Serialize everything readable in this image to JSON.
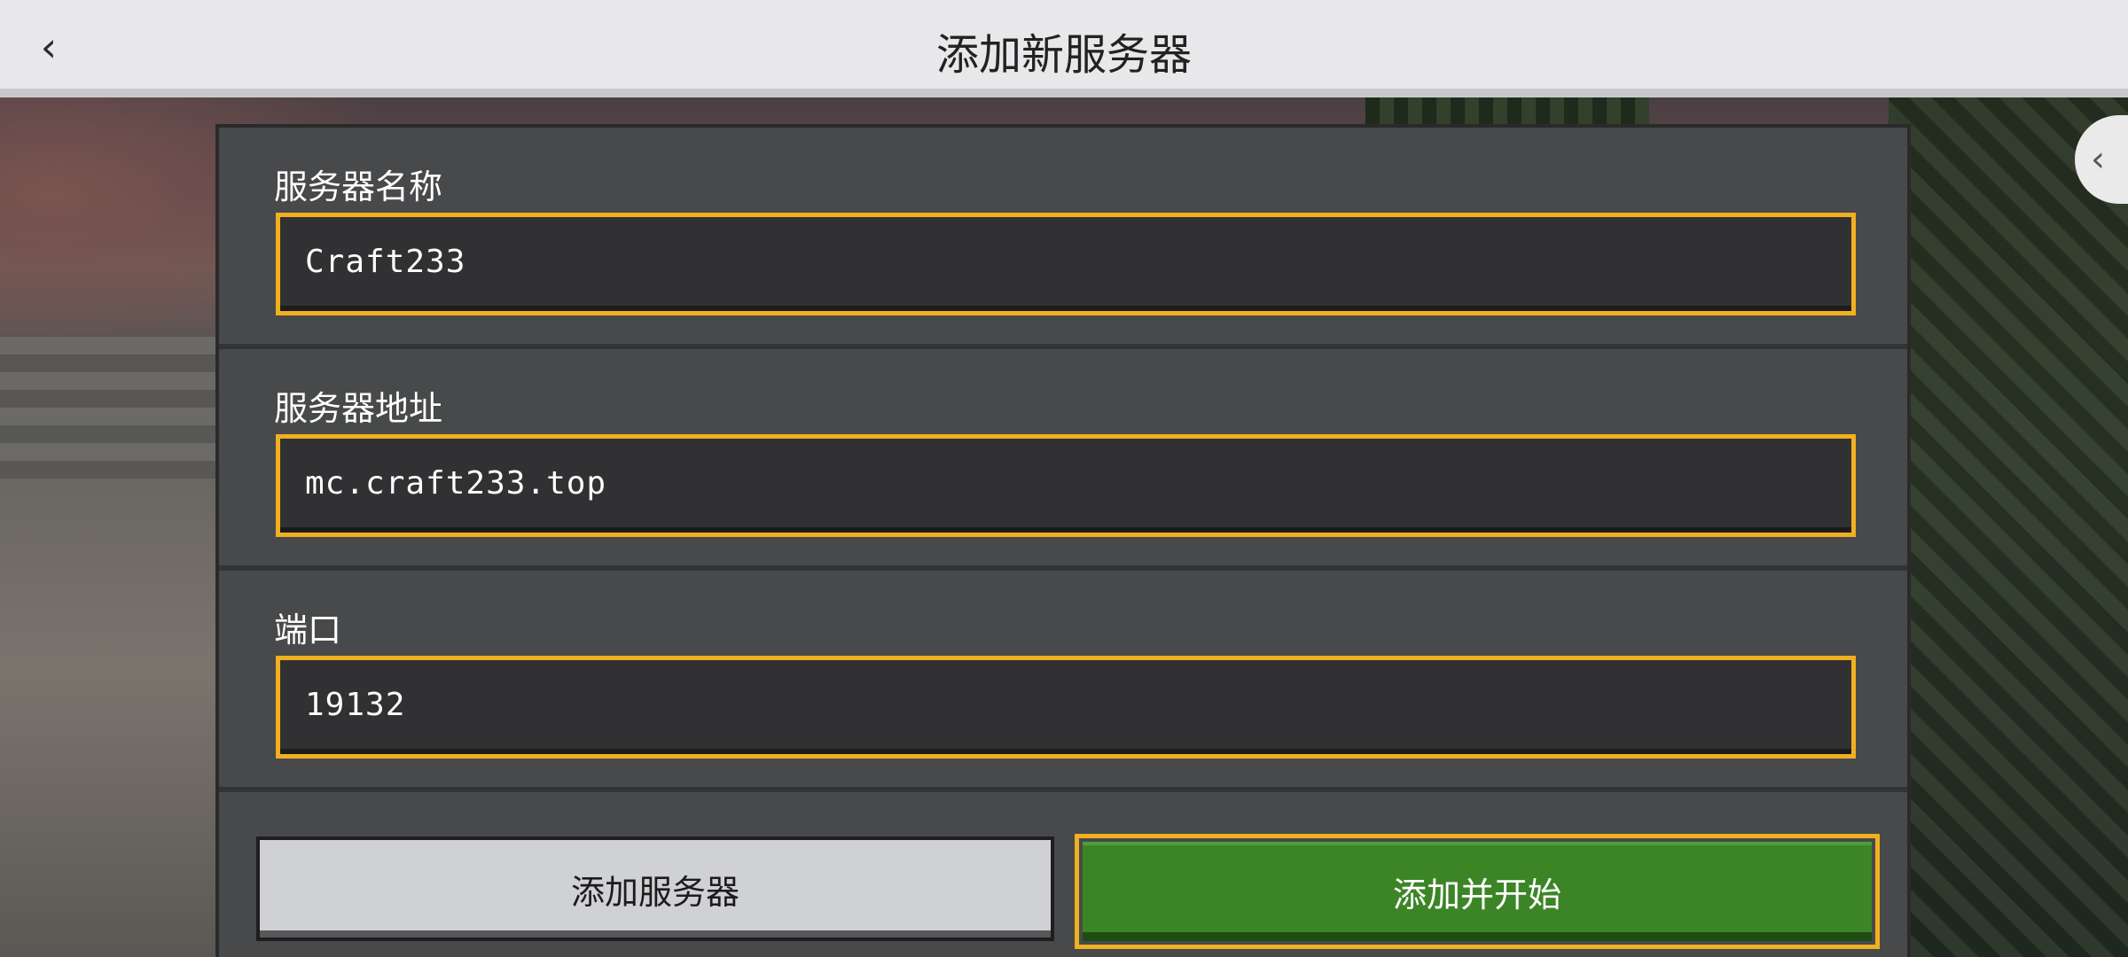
{
  "header": {
    "back_glyph": "‹",
    "title": "添加新服务器",
    "side_tab_glyph": "‹"
  },
  "form": {
    "server_name": {
      "label": "服务器名称",
      "value": "Craft233"
    },
    "server_address": {
      "label": "服务器地址",
      "value": "mc.craft233.top"
    },
    "port": {
      "label": "端口",
      "value": "19132"
    }
  },
  "buttons": {
    "add_server": "添加服务器",
    "add_and_start": "添加并开始"
  },
  "colors": {
    "focus_border": "#f0b020",
    "primary_button": "#3c8527",
    "secondary_button": "#d0d1d4",
    "panel": "#48494a",
    "topbar": "#e8e8ea"
  }
}
